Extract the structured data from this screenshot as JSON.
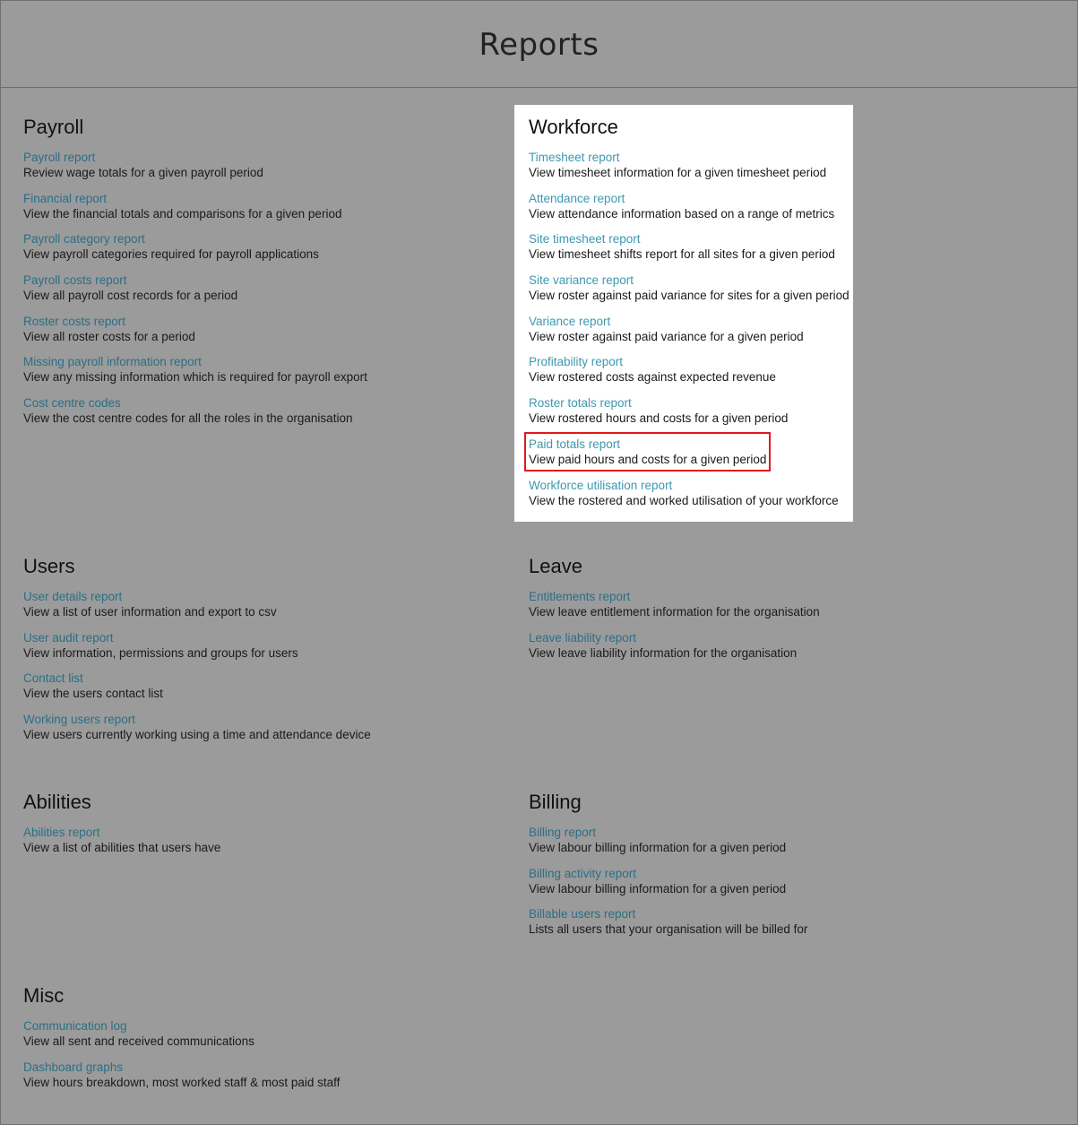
{
  "page": {
    "title": "Reports"
  },
  "sections": {
    "payroll": {
      "title": "Payroll",
      "items": [
        {
          "label": "Payroll report",
          "desc": "Review wage totals for a given payroll period"
        },
        {
          "label": "Financial report",
          "desc": "View the financial totals and comparisons for a given period"
        },
        {
          "label": "Payroll category report",
          "desc": "View payroll categories required for payroll applications"
        },
        {
          "label": "Payroll costs report",
          "desc": "View all payroll cost records for a period"
        },
        {
          "label": "Roster costs report",
          "desc": "View all roster costs for a period"
        },
        {
          "label": "Missing payroll information report",
          "desc": "View any missing information which is required for payroll export"
        },
        {
          "label": "Cost centre codes",
          "desc": "View the cost centre codes for all the roles in the organisation"
        }
      ]
    },
    "workforce": {
      "title": "Workforce",
      "items": [
        {
          "label": "Timesheet report",
          "desc": "View timesheet information for a given timesheet period"
        },
        {
          "label": "Attendance report",
          "desc": "View attendance information based on a range of metrics"
        },
        {
          "label": "Site timesheet report",
          "desc": "View timesheet shifts report for all sites for a given period"
        },
        {
          "label": "Site variance report",
          "desc": "View roster against paid variance for sites for a given period"
        },
        {
          "label": "Variance report",
          "desc": "View roster against paid variance for a given period"
        },
        {
          "label": "Profitability report",
          "desc": "View rostered costs against expected revenue"
        },
        {
          "label": "Roster totals report",
          "desc": "View rostered hours and costs for a given period"
        },
        {
          "label": "Paid totals report",
          "desc": "View paid hours and costs for a given period"
        },
        {
          "label": "Workforce utilisation report",
          "desc": "View the rostered and worked utilisation of your workforce"
        }
      ]
    },
    "users": {
      "title": "Users",
      "items": [
        {
          "label": "User details report",
          "desc": "View a list of user information and export to csv"
        },
        {
          "label": "User audit report",
          "desc": "View information, permissions and groups for users"
        },
        {
          "label": "Contact list",
          "desc": "View the users contact list"
        },
        {
          "label": "Working users report",
          "desc": "View users currently working using a time and attendance device"
        }
      ]
    },
    "leave": {
      "title": "Leave",
      "items": [
        {
          "label": "Entitlements report",
          "desc": "View leave entitlement information for the organisation"
        },
        {
          "label": "Leave liability report",
          "desc": "View leave liability information for the organisation"
        }
      ]
    },
    "abilities": {
      "title": "Abilities",
      "items": [
        {
          "label": "Abilities report",
          "desc": "View a list of abilities that users have"
        }
      ]
    },
    "billing": {
      "title": "Billing",
      "items": [
        {
          "label": "Billing report",
          "desc": "View labour billing information for a given period"
        },
        {
          "label": "Billing activity report",
          "desc": "View labour billing information for a given period"
        },
        {
          "label": "Billable users report",
          "desc": "Lists all users that your organisation will be billed for"
        }
      ]
    },
    "misc": {
      "title": "Misc",
      "items": [
        {
          "label": "Communication log",
          "desc": "View all sent and received communications"
        },
        {
          "label": "Dashboard graphs",
          "desc": "View hours breakdown, most worked staff & most paid staff"
        }
      ]
    }
  }
}
